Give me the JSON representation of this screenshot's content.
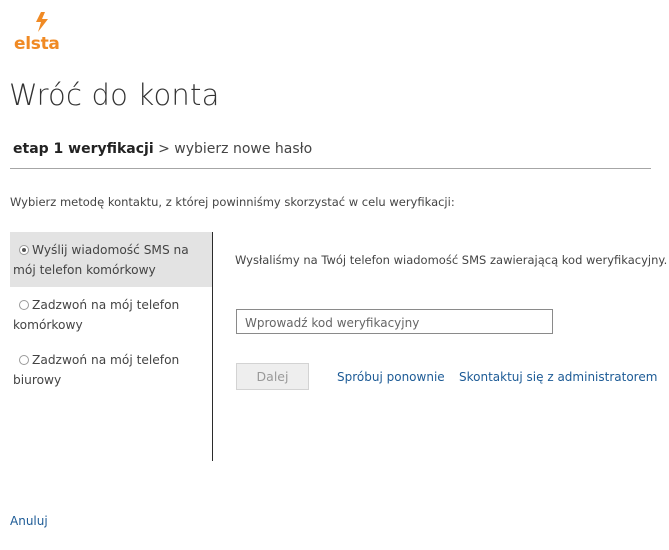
{
  "brand": {
    "logo_text": "elsta",
    "accent_color": "#f08a24"
  },
  "page": {
    "title": "Wróć do konta"
  },
  "breadcrumb": {
    "step_active": "etap 1 weryfikacji",
    "separator": ">",
    "step_next": "wybierz nowe hasło"
  },
  "instruction": "Wybierz metodę kontaktu, z której powinniśmy skorzystać w celu weryfikacji:",
  "options": [
    {
      "label": "Wyślij wiadomość SMS na mój telefon komórkowy",
      "selected": true
    },
    {
      "label": "Zadzwoń na mój telefon komórkowy",
      "selected": false
    },
    {
      "label": "Zadzwoń na mój telefon biurowy",
      "selected": false
    }
  ],
  "message": "Wysłaliśmy na Twój telefon wiadomość SMS zawierającą kod weryfikacyjny.",
  "code_input": {
    "placeholder": "Wprowadź kod weryfikacyjny",
    "value": ""
  },
  "actions": {
    "next_label": "Dalej",
    "retry_label": "Spróbuj ponownie",
    "admin_label": "Skontaktuj się z administratorem",
    "link_color": "#1d5b96"
  },
  "footer": {
    "cancel_label": "Anuluj"
  }
}
